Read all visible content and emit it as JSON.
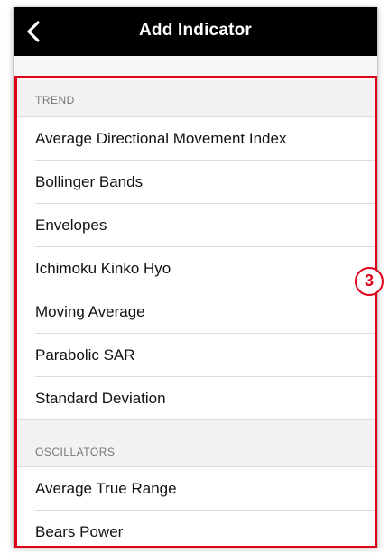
{
  "nav": {
    "title": "Add Indicator",
    "back_icon": "chevron-left-icon"
  },
  "sections": [
    {
      "header": "TREND",
      "items": [
        "Average Directional Movement Index",
        "Bollinger Bands",
        "Envelopes",
        "Ichimoku Kinko Hyo",
        "Moving Average",
        "Parabolic SAR",
        "Standard Deviation"
      ]
    },
    {
      "header": "OSCILLATORS",
      "items": [
        "Average True Range",
        "Bears Power"
      ]
    }
  ],
  "annotation": {
    "label": "3",
    "color": "#e0001a"
  }
}
